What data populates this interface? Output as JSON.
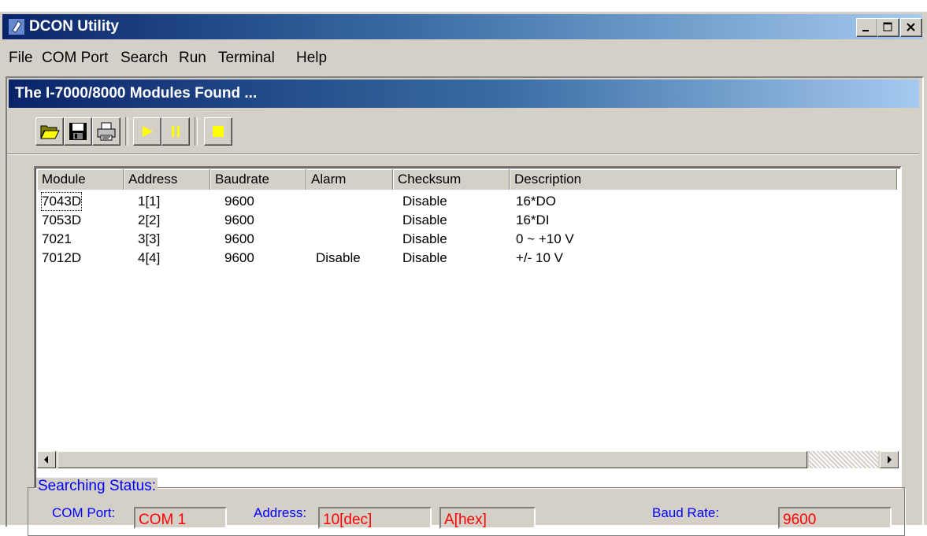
{
  "window": {
    "title": "DCON Utility"
  },
  "menu": [
    "File",
    "COM Port",
    "Search",
    "Run",
    "Terminal",
    "Help"
  ],
  "child_window": {
    "title": "The I-7000/8000 Modules Found ..."
  },
  "toolbar": [
    "open-icon",
    "save-icon",
    "print-icon",
    "run-icon",
    "pause-icon",
    "stop-icon"
  ],
  "table": {
    "columns": [
      "Module",
      "Address",
      "Baudrate",
      "Alarm",
      "Checksum",
      "Description"
    ],
    "rows": [
      {
        "module": "7043D",
        "address": "1[1]",
        "baudrate": "9600",
        "alarm": "",
        "checksum": "Disable",
        "description": "16*DO"
      },
      {
        "module": "7053D",
        "address": "2[2]",
        "baudrate": "9600",
        "alarm": "",
        "checksum": "Disable",
        "description": "16*DI"
      },
      {
        "module": "7021",
        "address": "3[3]",
        "baudrate": "9600",
        "alarm": "",
        "checksum": "Disable",
        "description": "0 ~ +10 V"
      },
      {
        "module": "7012D",
        "address": "4[4]",
        "baudrate": "9600",
        "alarm": "Disable",
        "checksum": "Disable",
        "description": "+/- 10 V"
      }
    ]
  },
  "status": {
    "title": "Searching Status:",
    "com_port_label": "COM Port:",
    "com_port_value": "COM 1",
    "address_label": "Address:",
    "address_dec": "10[dec]",
    "address_hex": "A[hex]",
    "baud_label": "Baud Rate:",
    "baud_value": "9600"
  },
  "colors": {
    "title_bar": "#0a246a",
    "status_label": "#0000ff",
    "status_value": "#ff0000",
    "face": "#d4d0c8"
  }
}
